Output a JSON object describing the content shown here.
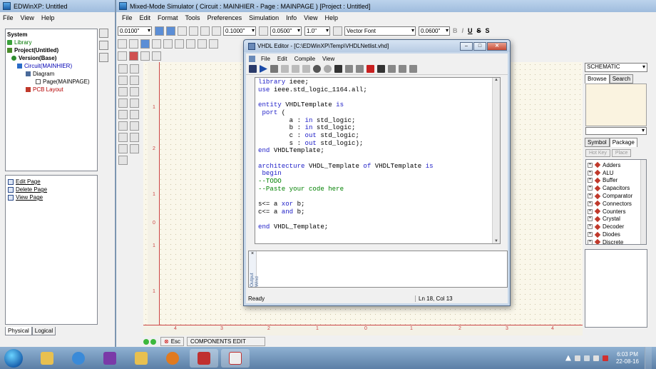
{
  "left_window": {
    "title": "EDWinXP: Untitled",
    "menu": [
      "File",
      "View",
      "Help"
    ],
    "tree": {
      "root": "System",
      "library": "Library",
      "project": "Project(Untitled)",
      "version": "Version(Base)",
      "circuit": "Circuit(MAINHIER)",
      "diagram": "Diagram",
      "page": "Page(MAINPAGE)",
      "pcb": "PCB Layout"
    },
    "page_actions": [
      "Edit Page",
      "Delete Page",
      "View Page"
    ],
    "tabs": [
      "Physical",
      "Logical"
    ]
  },
  "main_window": {
    "title": "Mixed-Mode Simulator ( Circuit : MAINHIER - Page : MAINPAGE ) [Project : Untitled]",
    "menu": [
      "File",
      "Edit",
      "Format",
      "Tools",
      "Preferences",
      "Simulation",
      "Info",
      "View",
      "Help"
    ],
    "toolbar": {
      "grid1": "0.0100\"",
      "grid2": "0.1000\"",
      "grid3": "0.0500\"",
      "line_width": "1.0\"",
      "font": "Vector Font",
      "font_size": "0.0600\"",
      "fmt_bold": "B",
      "fmt_italic": "I",
      "fmt_underline": "U",
      "fmt_strike": "S",
      "fmt_shadow": "S"
    },
    "vruler_labels": [
      "1",
      "2",
      "1",
      "0",
      "1",
      "1"
    ],
    "hruler_labels": [
      "4",
      "3",
      "2",
      "1",
      "0",
      "1",
      "2",
      "3",
      "4"
    ],
    "status": {
      "esc": "Esc",
      "mode": "COMPONENTS EDIT"
    }
  },
  "palette": {
    "mode": "SCHEMATIC",
    "tabs": [
      "Browse",
      "Search"
    ],
    "tabs2": [
      "Symbol",
      "Package"
    ],
    "buttons": [
      "Hot Key",
      "Place"
    ],
    "items": [
      "Adders",
      "ALU",
      "Buffer",
      "Capacitors",
      "Comparator",
      "Connectors",
      "Counters",
      "Crystal",
      "Decoder",
      "Diodes",
      "Discrete"
    ]
  },
  "vhdl_editor": {
    "title": "VHDL Editor - [C:\\EDWinXP\\Temp\\VHDLNetlist.vhd]",
    "menu": [
      "File",
      "Edit",
      "Compile",
      "View"
    ],
    "output_label": "Output Wind",
    "output_close": "×",
    "status_left": "Ready",
    "status_pos": "Ln 18, Col 13",
    "code": {
      "l1a": "library",
      "l1b": " ieee;",
      "l2a": "use",
      "l2b": " ieee.std_logic_1164.all;",
      "l4a": "entity",
      "l4b": " VHDLTemplate ",
      "l4c": "is",
      "l5a": " port",
      "l5b": " (",
      "l6a": "        a : ",
      "l6b": "in",
      "l6c": " std_logic;",
      "l7a": "        b : ",
      "l7b": "in",
      "l7c": " std_logic;",
      "l8a": "        c : ",
      "l8b": "out",
      "l8c": " std_logic;",
      "l9a": "        s : ",
      "l9b": "out",
      "l9c": " std_logic);",
      "l10a": "end",
      "l10b": " VHDLTemplate;",
      "l12a": "architecture",
      "l12b": " VHDL_Template ",
      "l12c": "of",
      "l12d": " VHDLTemplate ",
      "l12e": "is",
      "l13a": " begin",
      "l14a": "--TODO",
      "l15a": "--Paste your code here",
      "l17a": "s<= a ",
      "l17b": "xor",
      "l17c": " b;",
      "l18a": "c<= a ",
      "l18b": "and",
      "l18c": " b;",
      "l20a": "end",
      "l20b": " VHDL_Template;"
    }
  },
  "taskbar": {
    "time": "6:03 PM",
    "date": "22-08-16"
  }
}
